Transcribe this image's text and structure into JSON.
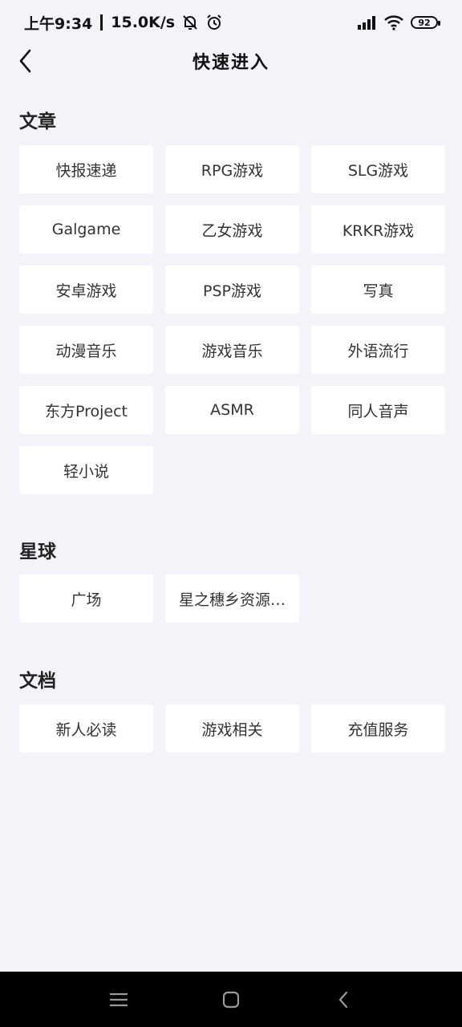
{
  "status_bar": {
    "time": "上午9:34",
    "network_speed": "15.0K/s",
    "battery": "92",
    "icons": [
      "mute-icon",
      "alarm-icon",
      "signal-icon",
      "wifi-icon",
      "battery-icon"
    ]
  },
  "header": {
    "title": "快速进入",
    "back_icon": "chevron-left-icon"
  },
  "sections": [
    {
      "title": "文章",
      "items": [
        "快报速递",
        "RPG游戏",
        "SLG游戏",
        "Galgame",
        "乙女游戏",
        "KRKR游戏",
        "安卓游戏",
        "PSP游戏",
        "写真",
        "动漫音乐",
        "游戏音乐",
        "外语流行",
        "东方Project",
        "ASMR",
        "同人音声",
        "轻小说"
      ]
    },
    {
      "title": "星球",
      "items": [
        "广场",
        "星之穗乡资源…"
      ]
    },
    {
      "title": "文档",
      "items": [
        "新人必读",
        "游戏相关",
        "充值服务"
      ]
    }
  ],
  "nav_bar": {
    "icons": [
      "menu-icon",
      "home-icon",
      "back-icon"
    ]
  },
  "colors": {
    "background": "#f3f4f9",
    "card": "#ffffff",
    "nav_bar": "#000000"
  }
}
